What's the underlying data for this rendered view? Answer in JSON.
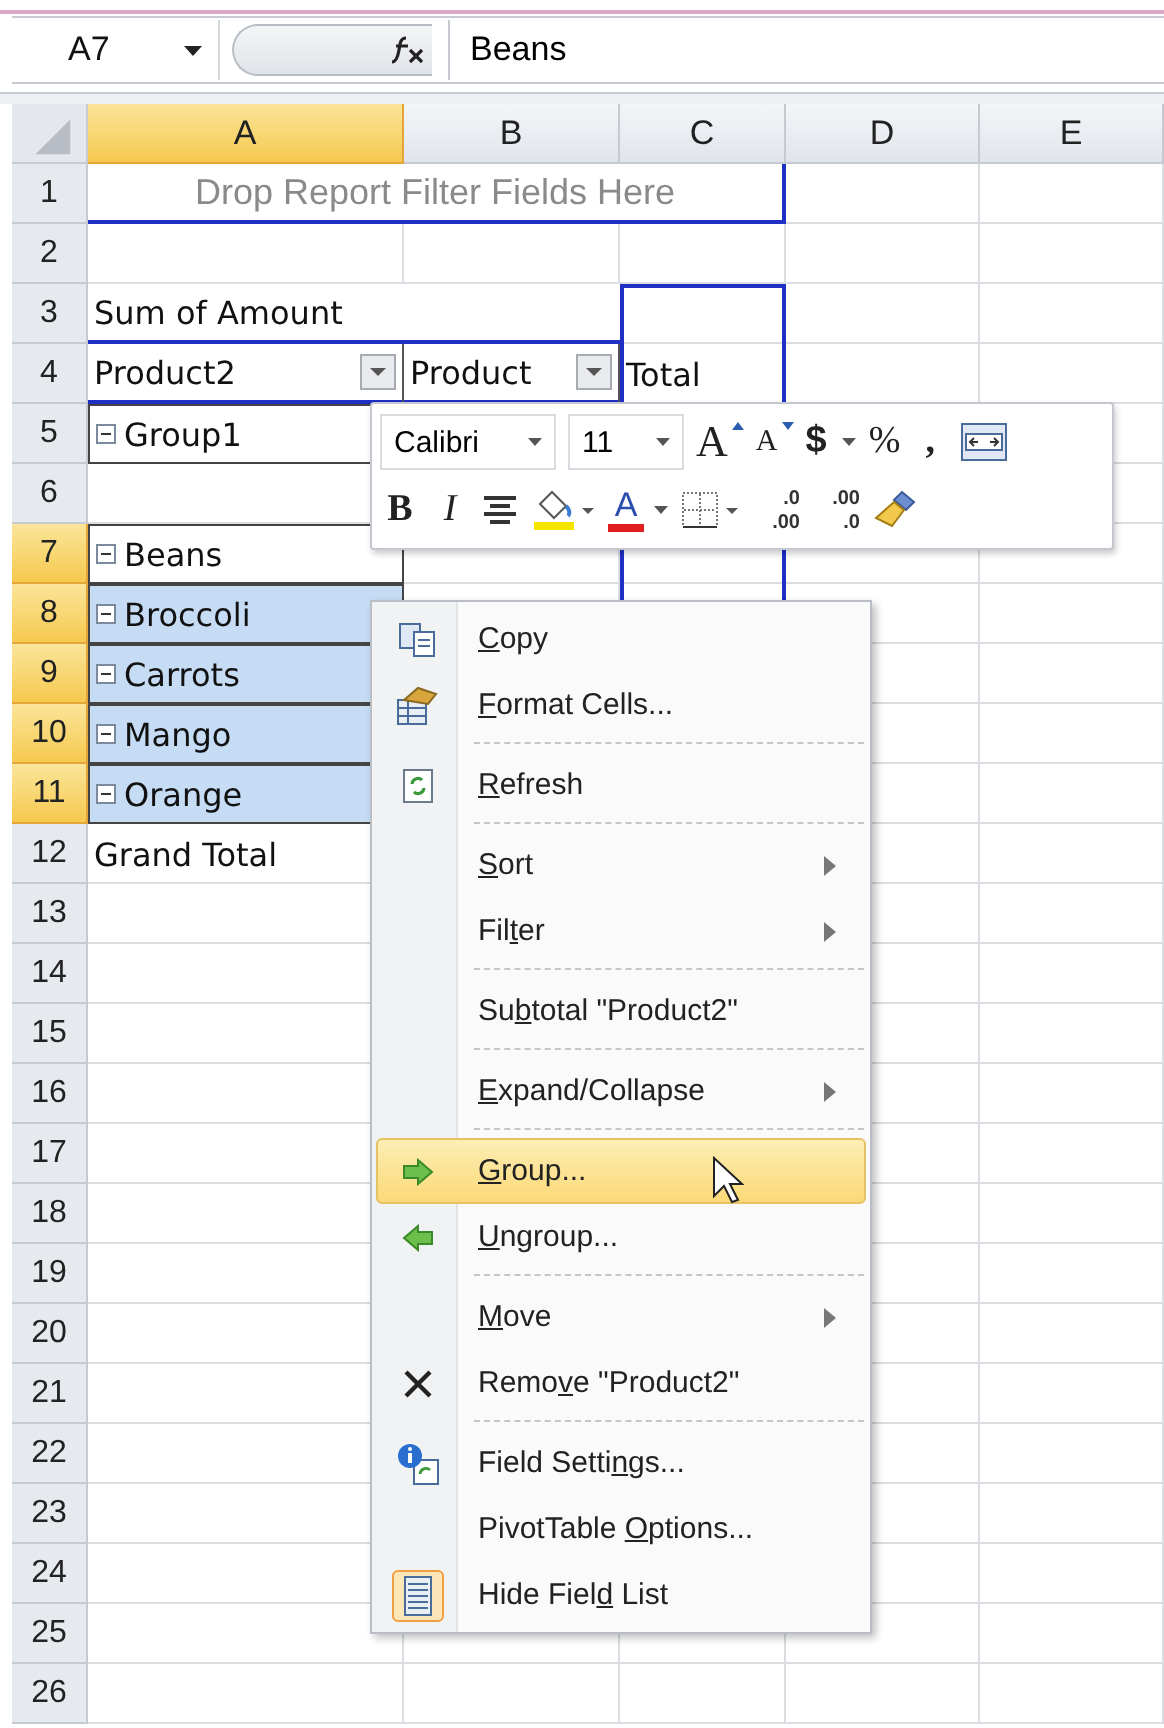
{
  "name_box": "A7",
  "formula": "Beans",
  "columns": [
    {
      "label": "A",
      "selected": true
    },
    {
      "label": "B",
      "selected": false
    },
    {
      "label": "C",
      "selected": false
    },
    {
      "label": "D",
      "selected": false
    },
    {
      "label": "E",
      "selected": false
    }
  ],
  "rows": [
    {
      "label": "1",
      "selected": false,
      "cells": [
        {
          "kind": "drop-zone",
          "text": "Drop Report Filter Fields Here",
          "selected": false
        }
      ]
    },
    {
      "label": "2",
      "selected": false,
      "cells": []
    },
    {
      "label": "3",
      "selected": false,
      "cells": [
        {
          "kind": "title",
          "text": "Sum of Amount",
          "selected": false
        }
      ]
    },
    {
      "label": "4",
      "selected": false,
      "cells": [
        {
          "kind": "field",
          "text": "Product2",
          "selected": false
        },
        {
          "kind": "field",
          "text": "Product",
          "selected": false
        },
        {
          "kind": "text",
          "text": "Total",
          "selected": false
        }
      ]
    },
    {
      "label": "5",
      "selected": false,
      "cells": [
        {
          "kind": "collapsible",
          "text": "Group1",
          "selected": false
        }
      ]
    },
    {
      "label": "6",
      "selected": false,
      "cells": []
    },
    {
      "label": "7",
      "selected": true,
      "cells": [
        {
          "kind": "collapsible",
          "text": "Beans",
          "selected": false
        }
      ]
    },
    {
      "label": "8",
      "selected": true,
      "cells": [
        {
          "kind": "collapsible",
          "text": "Broccoli",
          "selected": true
        }
      ]
    },
    {
      "label": "9",
      "selected": true,
      "cells": [
        {
          "kind": "collapsible",
          "text": "Carrots",
          "selected": true
        }
      ]
    },
    {
      "label": "10",
      "selected": true,
      "cells": [
        {
          "kind": "collapsible",
          "text": "Mango",
          "selected": true
        }
      ]
    },
    {
      "label": "11",
      "selected": true,
      "cells": [
        {
          "kind": "collapsible",
          "text": "Orange",
          "selected": true
        }
      ]
    },
    {
      "label": "12",
      "selected": false,
      "cells": [
        {
          "kind": "text",
          "text": "Grand Total",
          "selected": false
        }
      ]
    },
    {
      "label": "13",
      "selected": false,
      "cells": []
    },
    {
      "label": "14",
      "selected": false,
      "cells": []
    },
    {
      "label": "15",
      "selected": false,
      "cells": []
    },
    {
      "label": "16",
      "selected": false,
      "cells": []
    },
    {
      "label": "17",
      "selected": false,
      "cells": []
    },
    {
      "label": "18",
      "selected": false,
      "cells": []
    },
    {
      "label": "19",
      "selected": false,
      "cells": []
    },
    {
      "label": "20",
      "selected": false,
      "cells": []
    },
    {
      "label": "21",
      "selected": false,
      "cells": []
    },
    {
      "label": "22",
      "selected": false,
      "cells": []
    },
    {
      "label": "23",
      "selected": false,
      "cells": []
    },
    {
      "label": "24",
      "selected": false,
      "cells": []
    },
    {
      "label": "25",
      "selected": false,
      "cells": []
    },
    {
      "label": "26",
      "selected": false,
      "cells": []
    }
  ],
  "mini_toolbar": {
    "upper_controls": [
      {
        "kind": "font-combo",
        "text": "Calibri"
      },
      {
        "kind": "size-combo",
        "text": "11"
      },
      {
        "kind": "grow",
        "text": "A"
      },
      {
        "kind": "shrink",
        "text": "A"
      },
      {
        "kind": "currency",
        "text": "$"
      },
      {
        "kind": "percent",
        "text": "%"
      },
      {
        "kind": "comma",
        "text": ","
      },
      {
        "kind": "merge"
      }
    ],
    "lower_controls": [
      {
        "kind": "bold",
        "text": "B"
      },
      {
        "kind": "italic",
        "text": "I"
      },
      {
        "kind": "center"
      },
      {
        "kind": "fill-color"
      },
      {
        "kind": "font-color",
        "text": "A"
      },
      {
        "kind": "borders"
      },
      {
        "kind": "inc-decimal",
        "top": ".0",
        "bottom": ".00"
      },
      {
        "kind": "dec-decimal",
        "top": ".00",
        "bottom": ".0"
      },
      {
        "kind": "painter"
      }
    ]
  },
  "context_menu": [
    {
      "kind": "copy",
      "key": "C",
      "after": "opy",
      "submenu": false,
      "highlighted": false,
      "divider": false
    },
    {
      "kind": "format",
      "key": "F",
      "after": "ormat Cells...",
      "submenu": false,
      "highlighted": false,
      "divider": true
    },
    {
      "kind": "refresh",
      "key": "R",
      "after": "efresh",
      "submenu": false,
      "highlighted": false,
      "divider": true
    },
    {
      "kind": "plain",
      "key": "S",
      "after": "ort",
      "submenu": true,
      "highlighted": false,
      "divider": false
    },
    {
      "kind": "plain",
      "before": "Fil",
      "key": "t",
      "after": "er",
      "submenu": true,
      "highlighted": false,
      "divider": true
    },
    {
      "kind": "plain",
      "before": "Su",
      "key": "b",
      "after": "total \"Product2\"",
      "submenu": false,
      "highlighted": false,
      "divider": true
    },
    {
      "kind": "plain",
      "key": "E",
      "after": "xpand/Collapse",
      "submenu": true,
      "highlighted": false,
      "divider": true
    },
    {
      "kind": "group",
      "key": "G",
      "after": "roup...",
      "submenu": false,
      "highlighted": true,
      "divider": false
    },
    {
      "kind": "ungroup",
      "key": "U",
      "after": "ngroup...",
      "submenu": false,
      "highlighted": false,
      "divider": true
    },
    {
      "kind": "plain",
      "key": "M",
      "after": "ove",
      "submenu": true,
      "highlighted": false,
      "divider": false
    },
    {
      "kind": "remove",
      "before": "Remo",
      "key": "v",
      "after": "e \"Product2\"",
      "submenu": false,
      "highlighted": false,
      "divider": true
    },
    {
      "kind": "settings",
      "before": "Field Setti",
      "key": "n",
      "after": "gs...",
      "submenu": false,
      "highlighted": false,
      "divider": false
    },
    {
      "kind": "plain",
      "before": "PivotTable ",
      "key": "O",
      "after": "ptions...",
      "submenu": false,
      "highlighted": false,
      "divider": false
    },
    {
      "kind": "fieldlist",
      "before": "Hide Fiel",
      "key": "d",
      "after": " List",
      "submenu": false,
      "highlighted": false,
      "divider": false
    }
  ]
}
